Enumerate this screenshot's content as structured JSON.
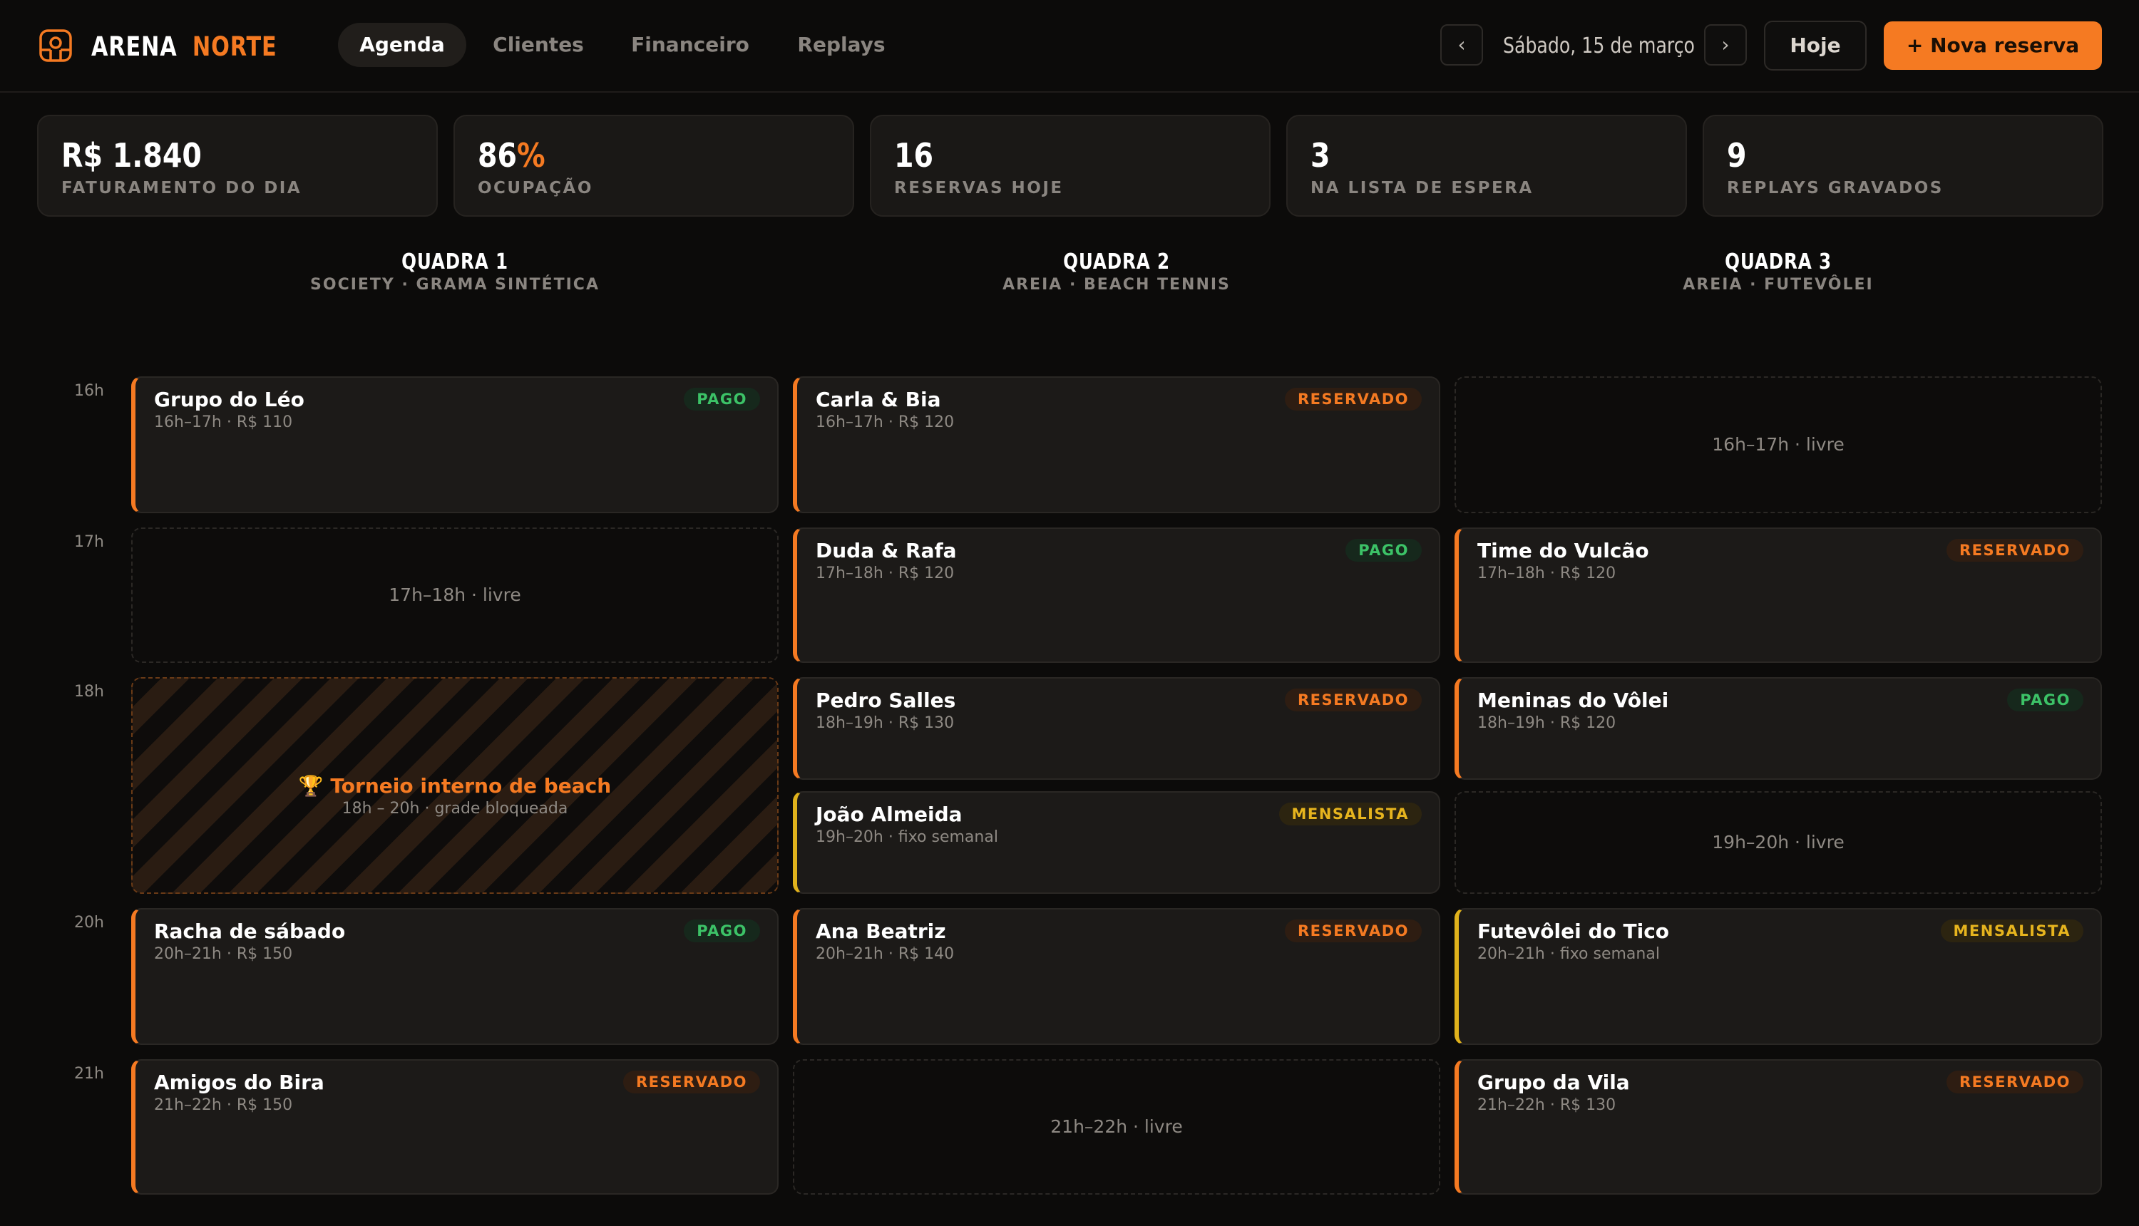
{
  "brand": {
    "word1": "ARENA",
    "word2": "NORTE",
    "accent_color": "#f57a22",
    "logo_icon": "court-icon"
  },
  "nav": {
    "tabs": [
      {
        "label": "Agenda",
        "active": true
      },
      {
        "label": "Clientes",
        "active": false
      },
      {
        "label": "Financeiro",
        "active": false
      },
      {
        "label": "Replays",
        "active": false
      }
    ]
  },
  "date_nav": {
    "prev": "‹",
    "next": "›",
    "date": "Sábado, 15 de março",
    "today_label": "Hoje"
  },
  "new_booking_label": "+ Nova reserva",
  "stats": [
    {
      "value": "R$ 1.840",
      "label": "FATURAMENTO DO DIA"
    },
    {
      "value": "86",
      "suffix": "%",
      "label": "OCUPAÇÃO"
    },
    {
      "value": "16",
      "label": "RESERVAS HOJE"
    },
    {
      "value": "3",
      "label": "NA LISTA DE ESPERA"
    },
    {
      "value": "9",
      "label": "REPLAYS GRAVADOS"
    }
  ],
  "courts": [
    {
      "title": "QUADRA 1",
      "subtitle": "SOCIETY · GRAMA SINTÉTICA"
    },
    {
      "title": "QUADRA 2",
      "subtitle": "AREIA · BEACH TENNIS"
    },
    {
      "title": "QUADRA 3",
      "subtitle": "AREIA · FUTEVÔLEI"
    }
  ],
  "hours": [
    "16h",
    "17h",
    "18h",
    "20h",
    "21h"
  ],
  "schedule": {
    "c1": [
      {
        "name": "Grupo do Léo",
        "meta": "16h–17h · R$ 110",
        "status": "PAGO"
      },
      {
        "free": "17h–18h · livre"
      },
      {
        "blocked_title": "🏆 Torneio interno de beach",
        "blocked_meta": "18h – 20h · grade bloqueada"
      },
      {
        "name": "Racha de sábado",
        "meta": "20h–21h · R$ 150",
        "status": "PAGO"
      },
      {
        "name": "Amigos do Bira",
        "meta": "21h–22h · R$ 150",
        "status": "RESERVADO"
      }
    ],
    "c2": [
      {
        "name": "Carla & Bia",
        "meta": "16h–17h · R$ 120",
        "status": "RESERVADO"
      },
      {
        "name": "Duda & Rafa",
        "meta": "17h–18h · R$ 120",
        "status": "PAGO"
      },
      {
        "name": "Pedro Salles",
        "meta": "18h–19h · R$ 130",
        "status": "RESERVADO"
      },
      {
        "name": "João Almeida",
        "meta": "19h–20h · fixo semanal",
        "status": "MENSALISTA"
      },
      {
        "name": "Ana Beatriz",
        "meta": "20h–21h · R$ 140",
        "status": "RESERVADO"
      },
      {
        "free": "21h–22h · livre"
      }
    ],
    "c3": [
      {
        "free": "16h–17h · livre"
      },
      {
        "name": "Time do Vulcão",
        "meta": "17h–18h · R$ 120",
        "status": "RESERVADO"
      },
      {
        "name": "Meninas do Vôlei",
        "meta": "18h–19h · R$ 120",
        "status": "PAGO"
      },
      {
        "free": "19h–20h · livre"
      },
      {
        "name": "Futevôlei do Tico",
        "meta": "20h–21h · fixo semanal",
        "status": "MENSALISTA"
      },
      {
        "name": "Grupo da Vila",
        "meta": "21h–22h · R$ 130",
        "status": "RESERVADO"
      }
    ]
  }
}
